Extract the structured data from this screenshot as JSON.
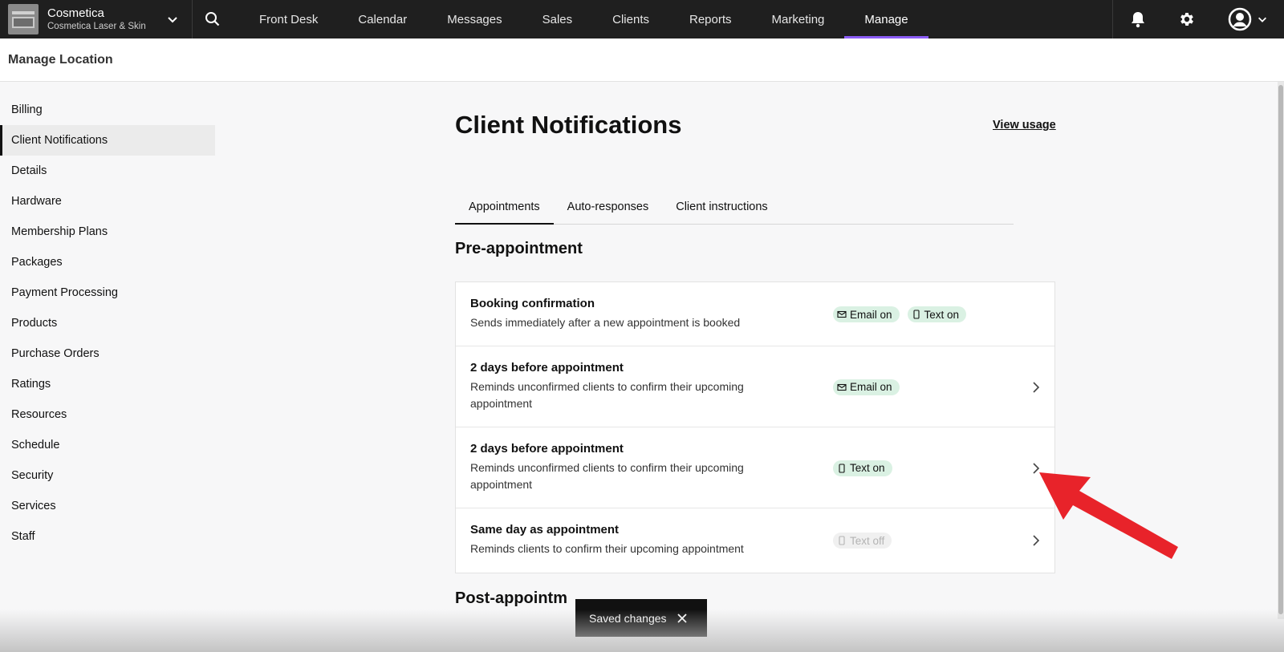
{
  "brand": {
    "name": "Cosmetica",
    "location": "Cosmetica Laser & Skin"
  },
  "nav": {
    "items": [
      {
        "label": "Front Desk"
      },
      {
        "label": "Calendar"
      },
      {
        "label": "Messages"
      },
      {
        "label": "Sales"
      },
      {
        "label": "Clients"
      },
      {
        "label": "Reports"
      },
      {
        "label": "Marketing"
      },
      {
        "label": "Manage",
        "active": true
      }
    ]
  },
  "subheader": {
    "title": "Manage Location"
  },
  "sidebar": {
    "items": [
      {
        "label": "Billing"
      },
      {
        "label": "Client Notifications",
        "active": true
      },
      {
        "label": "Details"
      },
      {
        "label": "Hardware"
      },
      {
        "label": "Membership Plans"
      },
      {
        "label": "Packages"
      },
      {
        "label": "Payment Processing"
      },
      {
        "label": "Products"
      },
      {
        "label": "Purchase Orders"
      },
      {
        "label": "Ratings"
      },
      {
        "label": "Resources"
      },
      {
        "label": "Schedule"
      },
      {
        "label": "Security"
      },
      {
        "label": "Services"
      },
      {
        "label": "Staff"
      }
    ]
  },
  "main": {
    "title": "Client Notifications",
    "view_usage": "View usage",
    "tabs": [
      {
        "label": "Appointments",
        "active": true
      },
      {
        "label": "Auto-responses"
      },
      {
        "label": "Client instructions"
      }
    ],
    "pre_title": "Pre-appointment",
    "post_title": "Post-appointm",
    "cards": [
      {
        "title": "Booking confirmation",
        "desc": "Sends immediately after a new appointment is booked",
        "badges": [
          {
            "icon": "mail-icon",
            "label": "Email on"
          },
          {
            "icon": "phone-icon",
            "label": "Text on"
          }
        ]
      },
      {
        "title": "2 days before appointment",
        "desc": "Reminds unconfirmed clients to confirm their upcoming appointment",
        "badges": [
          {
            "icon": "mail-icon",
            "label": "Email on"
          }
        ]
      },
      {
        "title": "2 days before appointment",
        "desc": "Reminds unconfirmed clients to confirm their upcoming appointment",
        "badges": [
          {
            "icon": "phone-icon",
            "label": "Text on"
          }
        ]
      },
      {
        "title": "Same day as appointment",
        "desc": "Reminds clients to confirm their upcoming appointment",
        "badges": [
          {
            "icon": "phone-icon",
            "label": "Text off",
            "off": true
          }
        ]
      }
    ]
  },
  "toast": {
    "label": "Saved changes"
  },
  "colors": {
    "topbar": "#1f1f1f",
    "accent": "#8b5cf6",
    "badge_on": "#daf1e3",
    "arrow": "#e8232a"
  }
}
